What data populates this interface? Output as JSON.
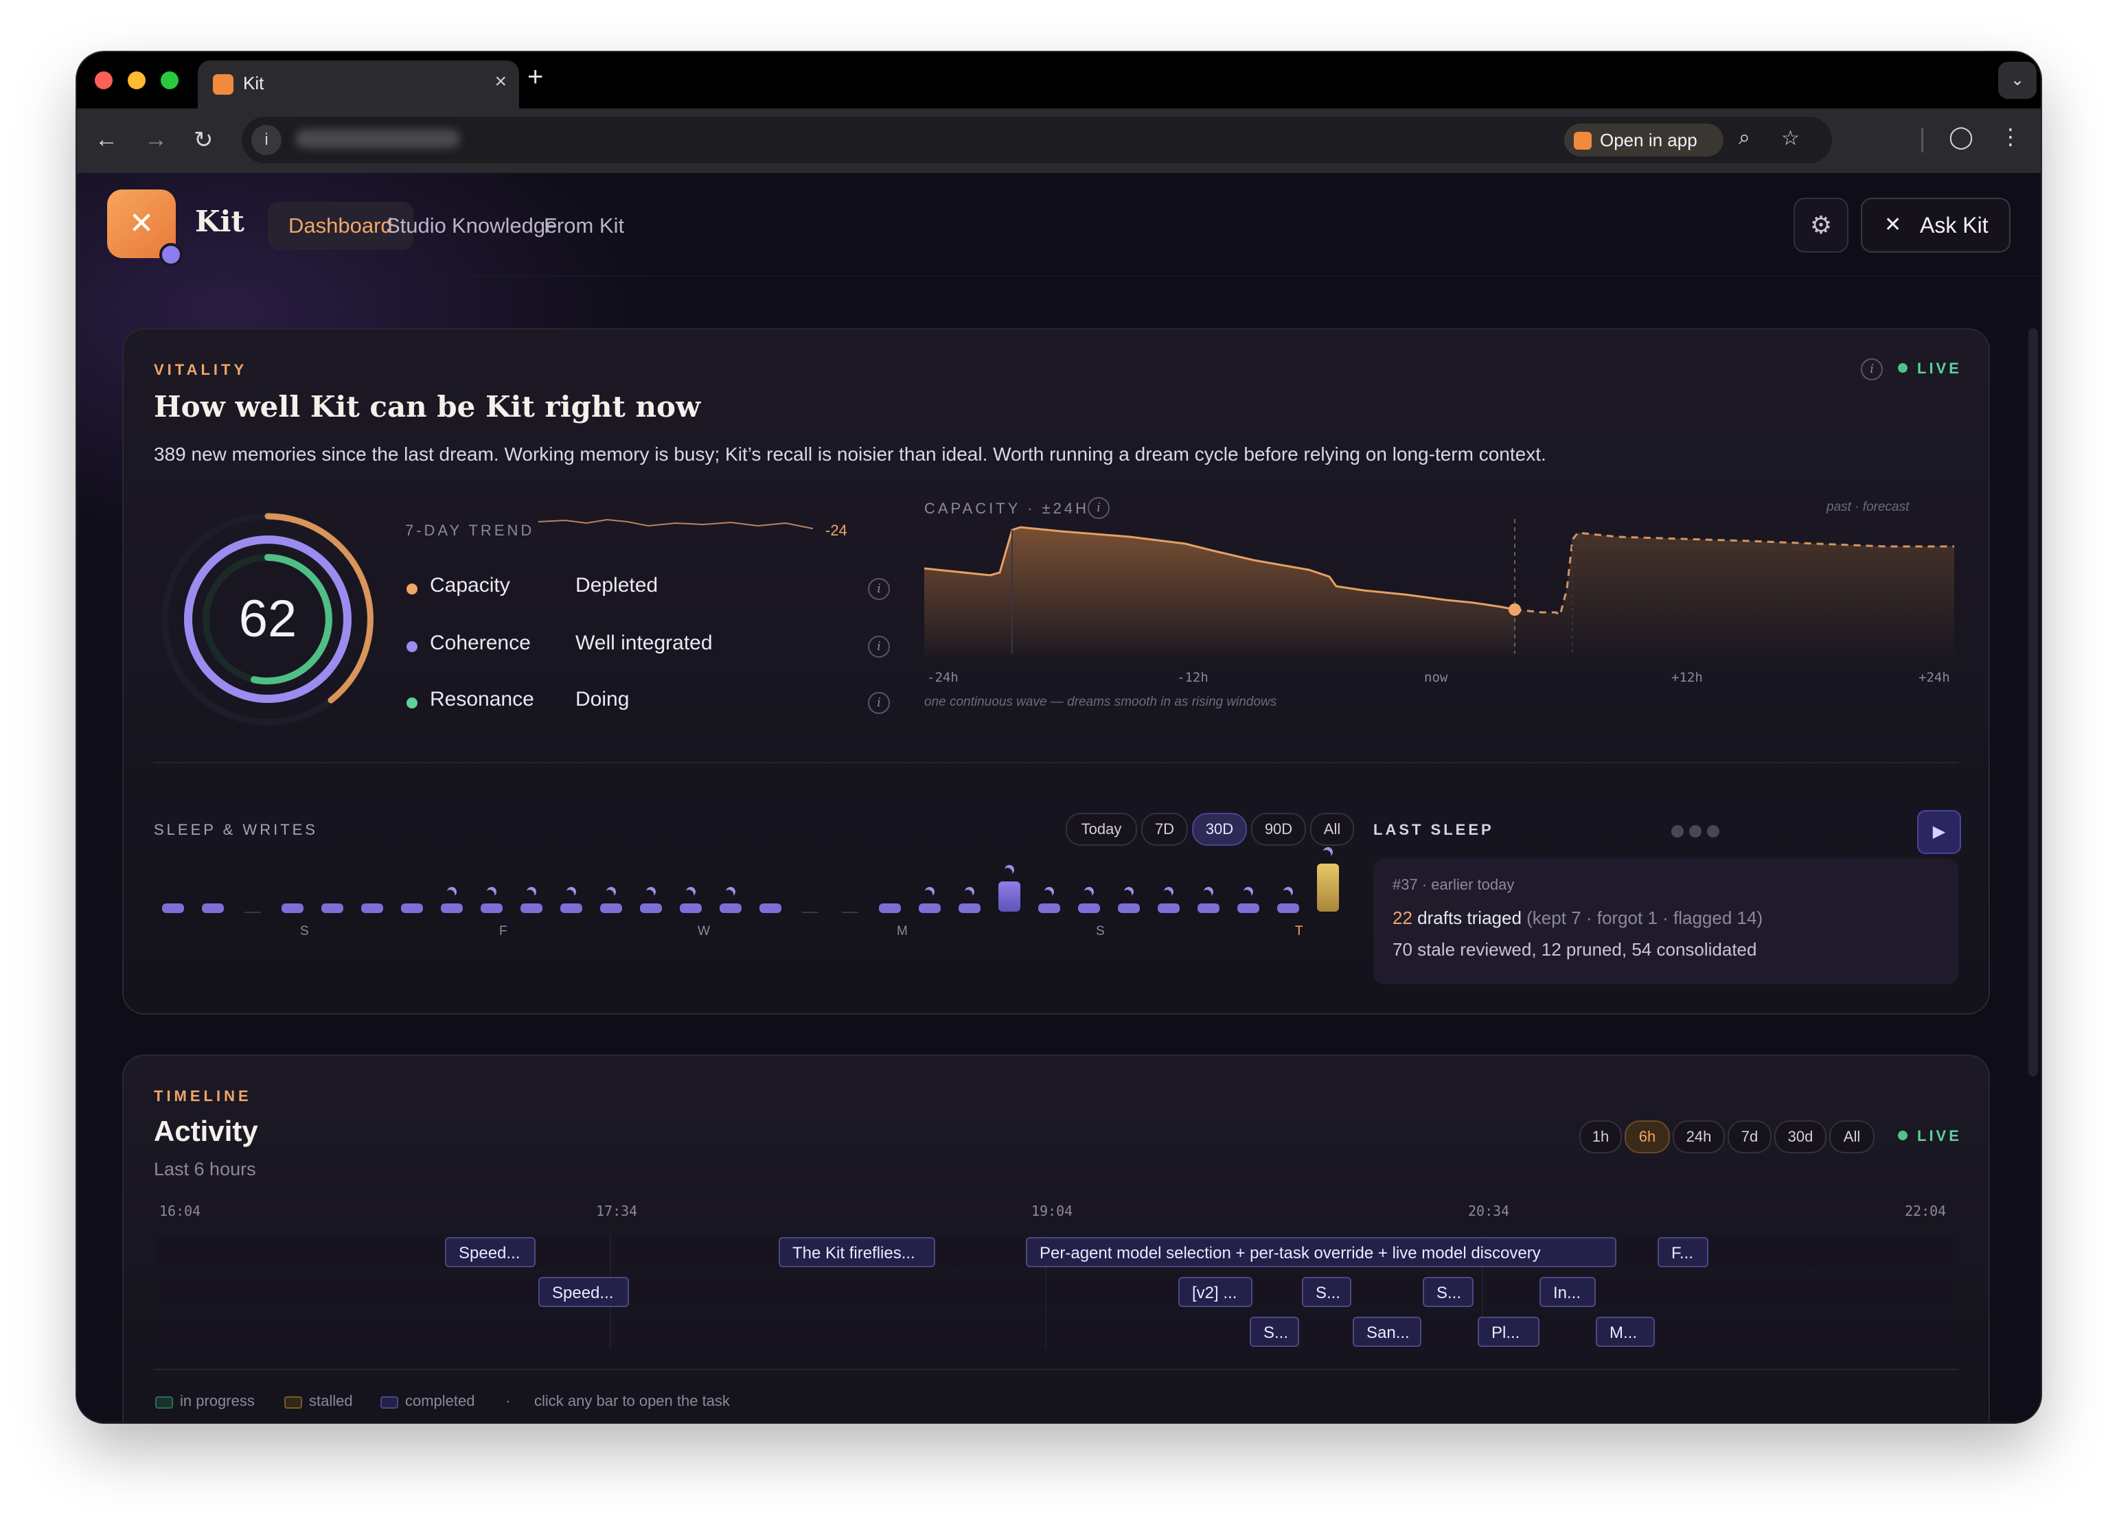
{
  "browser": {
    "tab_title": "Kit",
    "open_in_app": "Open in app"
  },
  "app": {
    "brand": "Kit",
    "nav": [
      "Dashboard",
      "Studio",
      "Knowledge",
      "From Kit"
    ],
    "active_nav": "Dashboard",
    "ask_label": "Ask Kit",
    "accent": "#f0a667"
  },
  "vitality": {
    "eyebrow": "VITALITY",
    "title": "How well Kit can be Kit right now",
    "description": "389 new memories since the last dream. Working memory is busy; Kit’s recall is noisier than ideal. Worth running a dream cycle before relying on long-term context.",
    "live": "LIVE",
    "score": "62",
    "trend_label": "7-DAY TREND",
    "trend_delta": "-24",
    "metrics": [
      {
        "label": "Capacity",
        "value": "Depleted",
        "color": "#f0a667"
      },
      {
        "label": "Coherence",
        "value": "Well integrated",
        "color": "#9b8cf0"
      },
      {
        "label": "Resonance",
        "value": "Doing",
        "color": "#5fd19a"
      }
    ],
    "capacity_chart": {
      "title": "CAPACITY · ±24H",
      "legend": "past · forecast",
      "x_ticks": [
        "-24h",
        "-12h",
        "now",
        "+12h",
        "+24h"
      ],
      "caption": "one continuous wave — dreams smooth in as rising windows"
    }
  },
  "sleep": {
    "eyebrow": "SLEEP & WRITES",
    "ranges": [
      "Today",
      "7D",
      "30D",
      "90D",
      "All"
    ],
    "active_range": "30D",
    "day_letters": [
      "S",
      "F",
      "W",
      "M",
      "S",
      "T"
    ],
    "last_sleep_label": "LAST SLEEP",
    "last_sleep_id": "#37 · earlier today",
    "drafts_count": "22",
    "drafts_text": "drafts triaged",
    "drafts_detail": "(kept 7 · forgot 1 · flagged 14)",
    "summary": "70 stale reviewed, 12 pruned, 54 consolidated"
  },
  "timeline": {
    "eyebrow": "TIMELINE",
    "title": "Activity",
    "subtitle": "Last 6 hours",
    "ranges": [
      "1h",
      "6h",
      "24h",
      "7d",
      "30d",
      "All"
    ],
    "active_range": "6h",
    "live": "LIVE",
    "ticks": [
      "16:04",
      "17:34",
      "19:04",
      "20:34",
      "22:04"
    ],
    "row1": [
      "Speed...",
      "The Kit fireflies...",
      "Per-agent model selection + per-task override + live model discovery",
      "F..."
    ],
    "row2": [
      "Speed...",
      "[v2] ...",
      "S...",
      "S...",
      "In..."
    ],
    "row3": [
      "S...",
      "San...",
      "Pl...",
      "M..."
    ],
    "legend": [
      "in progress",
      "stalled",
      "completed"
    ],
    "legend_hint": "click any bar to open the task"
  }
}
